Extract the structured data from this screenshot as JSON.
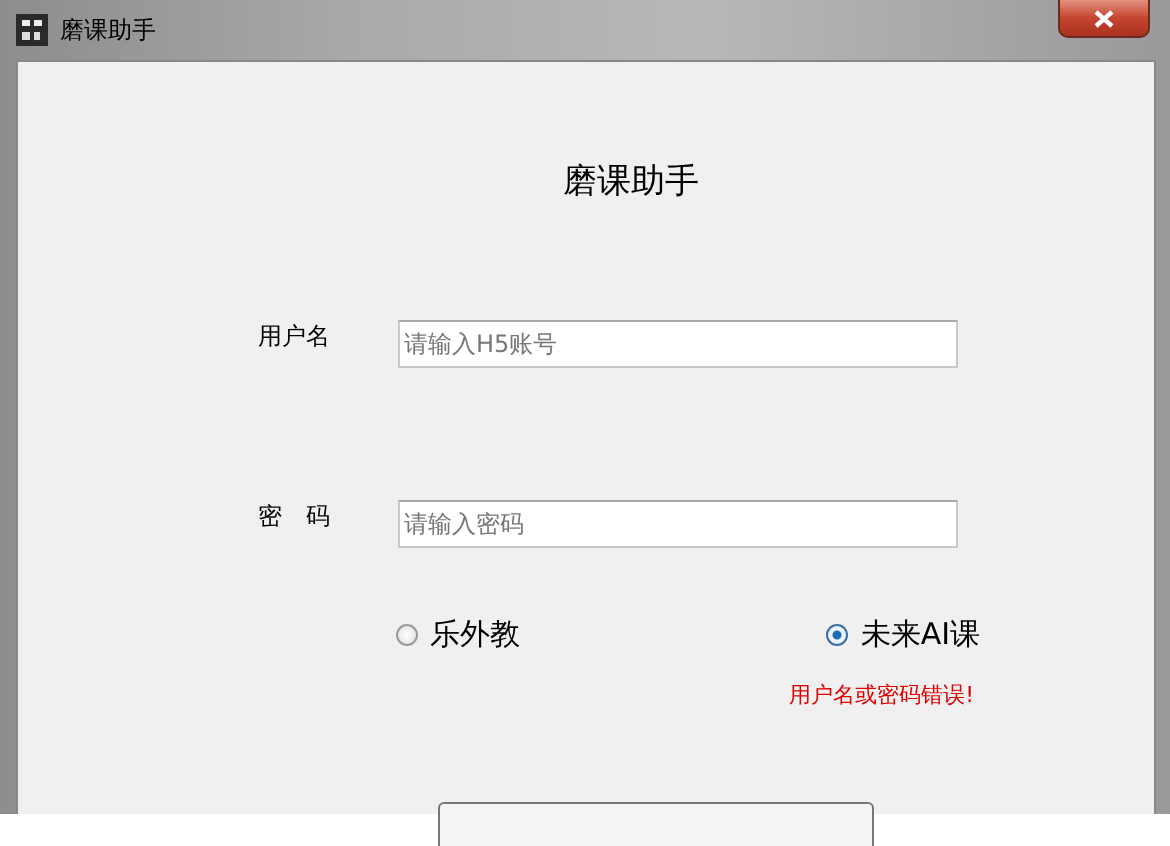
{
  "window": {
    "title": "磨课助手"
  },
  "heading": "磨课助手",
  "fields": [
    {
      "label": "用户名",
      "placeholder": "请输入H5账号"
    },
    {
      "label": "密　码",
      "placeholder": "请输入密码"
    }
  ],
  "options": [
    {
      "label": "乐外教",
      "selected": false
    },
    {
      "label": "未来AI课",
      "selected": true
    }
  ],
  "error": "用户名或密码错误!"
}
